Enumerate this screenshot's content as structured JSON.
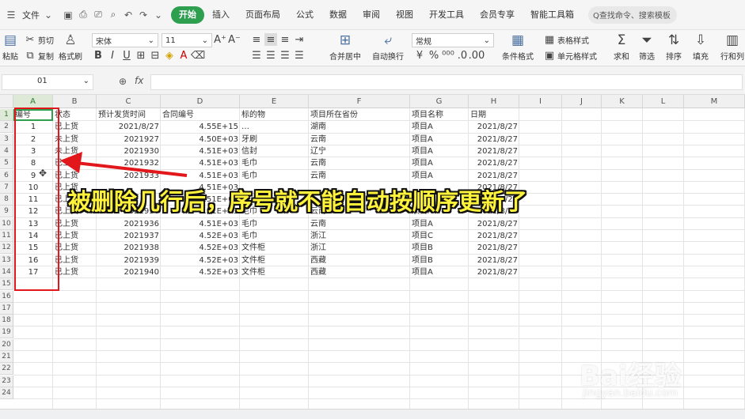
{
  "menubar": {
    "file": "文件",
    "tabs": [
      "开始",
      "插入",
      "页面布局",
      "公式",
      "数据",
      "审阅",
      "视图",
      "开发工具",
      "会员专享",
      "智能工具箱"
    ],
    "search": "Q查找命令、搜索模板"
  },
  "ribbon": {
    "paste": "粘贴",
    "cut": "剪切",
    "copy": "复制",
    "format_painter": "格式刷",
    "font_name": "宋体",
    "font_size": "11",
    "merge_center": "合并居中",
    "wrap": "自动换行",
    "number_format": "常规",
    "cond_format": "条件格式",
    "table_style": "表格样式",
    "cell_style": "单元格样式",
    "sum": "求和",
    "filter": "筛选",
    "sort": "排序",
    "fill": "填充",
    "col_height": "行和列"
  },
  "formula_bar": {
    "name_box": "01",
    "fx": "fx"
  },
  "sheet": {
    "columns": [
      "A",
      "B",
      "C",
      "D",
      "E",
      "F",
      "G",
      "H",
      "I",
      "J",
      "K",
      "L",
      "M"
    ],
    "row_numbers": [
      "1",
      "2",
      "3",
      "4",
      "5",
      "6",
      "7",
      "8",
      "9",
      "10",
      "11",
      "12",
      "13",
      "14",
      "15",
      "16",
      "17",
      "18",
      "19",
      "20",
      "21",
      "22",
      "23",
      "24"
    ],
    "header": [
      "编号",
      "状态",
      "预计发货时间",
      "合同编号",
      "标的物",
      "项目所在省份",
      "项目名称",
      "日期"
    ],
    "rows": [
      [
        "1",
        "已上货",
        "2021/8/27",
        "4.55E+15",
        "…",
        "湖南",
        "项目A",
        "2021/8/27"
      ],
      [
        "2",
        "未上货",
        "2021927",
        "4.50E+03",
        "牙刷",
        "云南",
        "项目A",
        "2021/8/27"
      ],
      [
        "3",
        "未上货",
        "2021930",
        "4.51E+03",
        "信封",
        "辽宁",
        "项目A",
        "2021/8/27"
      ],
      [
        "8",
        "已上货",
        "2021932",
        "4.51E+03",
        "毛巾",
        "云南",
        "项目A",
        "2021/8/27"
      ],
      [
        "9",
        "已上货",
        "2021933",
        "4.51E+03",
        "毛巾",
        "云南",
        "项目A",
        "2021/8/27"
      ],
      [
        "10",
        "已上货",
        "",
        "4.51E+03",
        "",
        "",
        "",
        "2021/8/27"
      ],
      [
        "11",
        "已上货",
        "",
        "4.51E+03",
        "",
        "",
        "",
        "2021/8/27"
      ],
      [
        "12",
        "已上货",
        "2021936",
        "4.51E+03",
        "毛巾",
        "云南",
        "项目A",
        "2021/8/27"
      ],
      [
        "13",
        "已上货",
        "2021936",
        "4.51E+03",
        "毛巾",
        "云南",
        "项目A",
        "2021/8/27"
      ],
      [
        "14",
        "已上货",
        "2021937",
        "4.52E+03",
        "毛巾",
        "浙江",
        "项目C",
        "2021/8/27"
      ],
      [
        "15",
        "已上货",
        "2021938",
        "4.52E+03",
        "文件柜",
        "浙江",
        "项目B",
        "2021/8/27"
      ],
      [
        "16",
        "已上货",
        "2021939",
        "4.52E+03",
        "文件柜",
        "西藏",
        "项目B",
        "2021/8/27"
      ],
      [
        "17",
        "已上货",
        "2021940",
        "4.52E+03",
        "文件柜",
        "西藏",
        "项目A",
        "2021/8/27"
      ]
    ]
  },
  "annotation": {
    "caption": "被删除几行后，序号就不能自动按顺序更新了",
    "accent": "#e2171b"
  },
  "watermark": {
    "brand": "Bai经验",
    "url": "jingyan.baidu.com"
  }
}
